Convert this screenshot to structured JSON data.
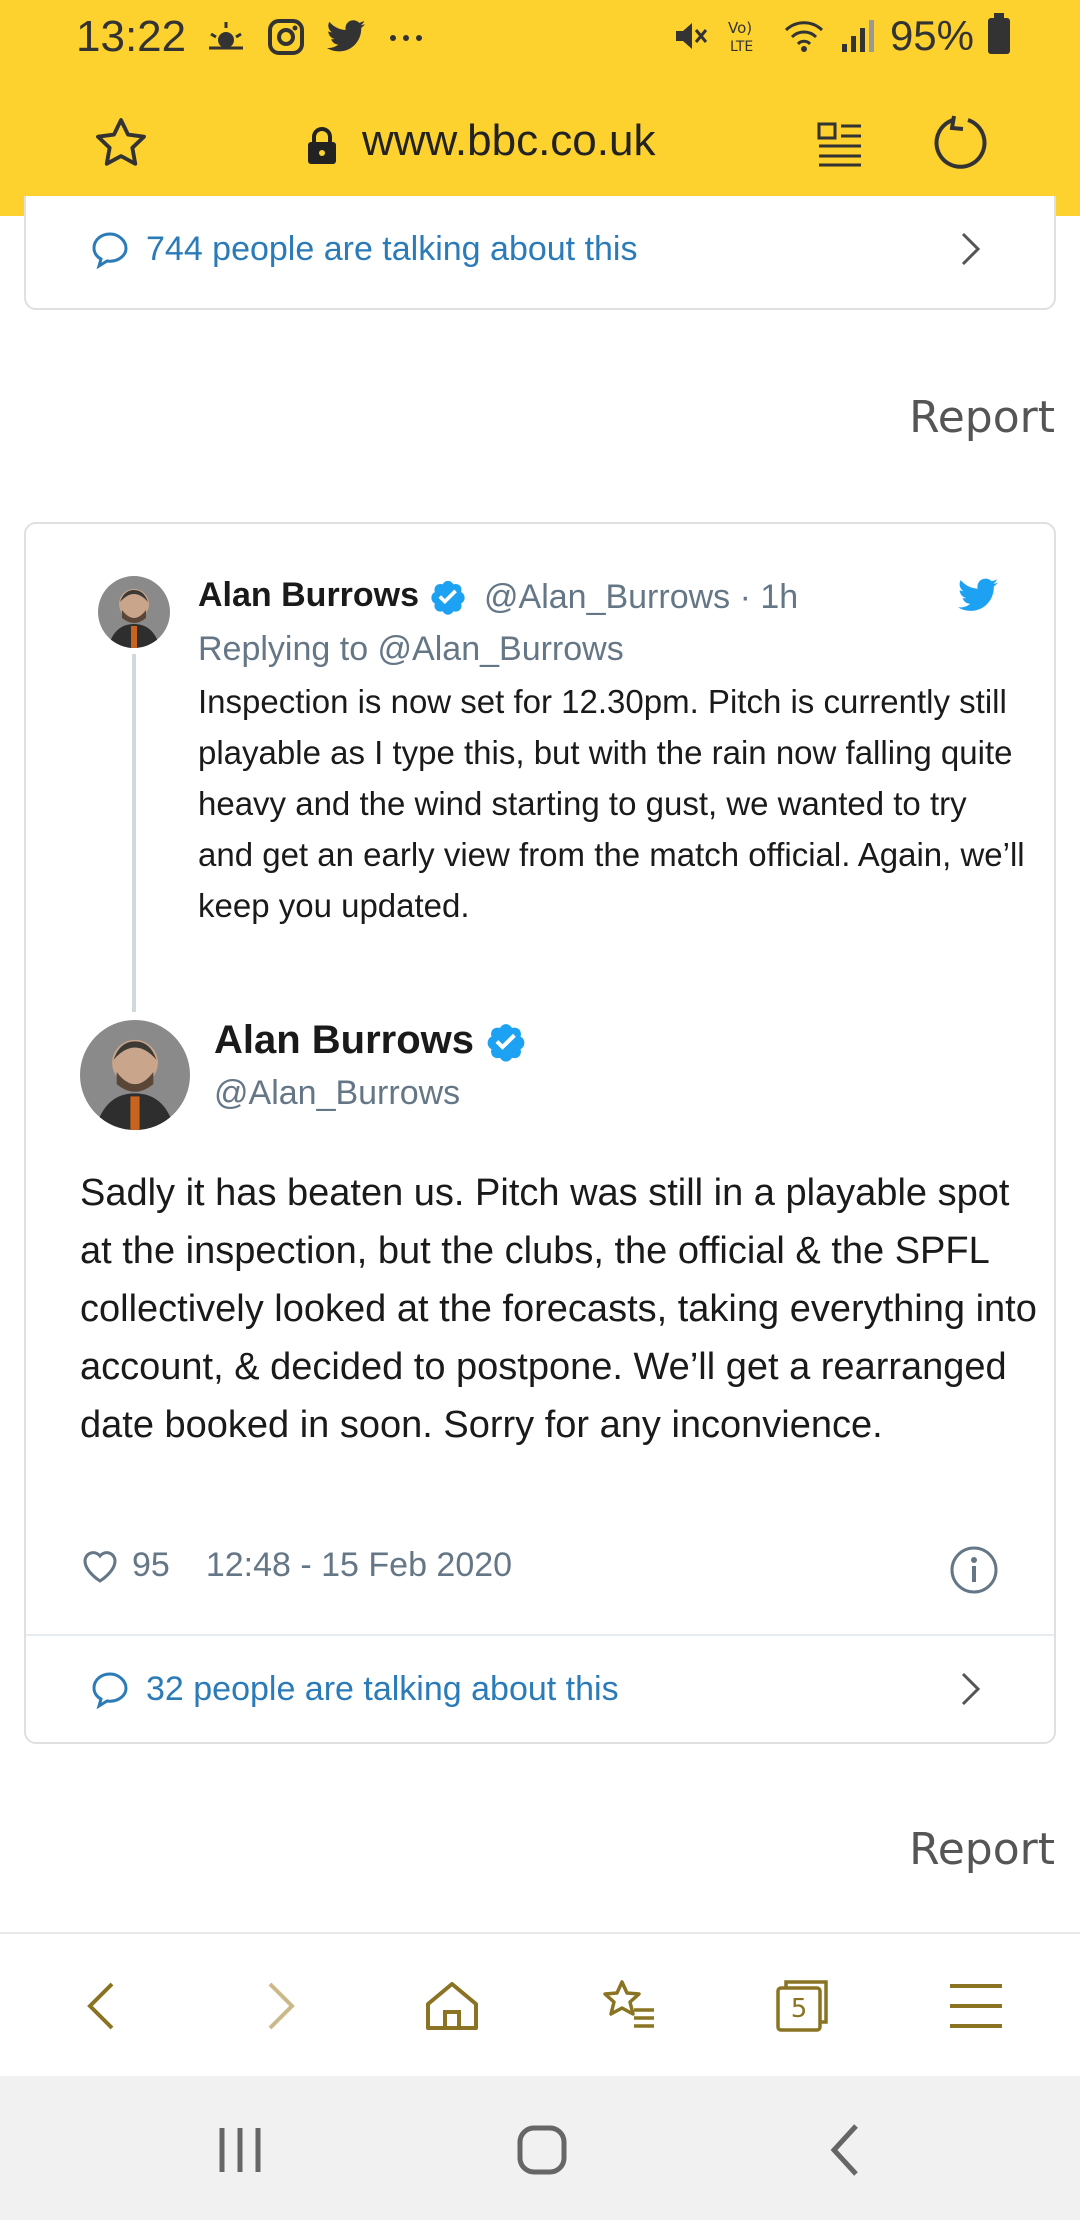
{
  "status_bar": {
    "time": "13:22",
    "battery": "95%",
    "notification_icons": [
      "weather-icon",
      "instagram-icon",
      "twitter-icon",
      "more-icon"
    ]
  },
  "browser": {
    "url": "www.bbc.co.uk",
    "accent_color": "#FDD22F"
  },
  "embed_prev": {
    "talk_text": "744 people are talking about this"
  },
  "report_1": "Report",
  "tweet": {
    "quoted": {
      "name": "Alan Burrows",
      "handle_time": "@Alan_Burrows · 1h",
      "replying_to": "Replying to @Alan_Burrows",
      "text": "Inspection is now set for 12.30pm. Pitch is currently still playable as I type this, but with the rain now falling quite heavy and the wind starting to gust, we wanted to try and get an early view from the match official. Again, we’ll keep you updated."
    },
    "main": {
      "name": "Alan Burrows",
      "handle": "@Alan_Burrows",
      "text": "Sadly it has beaten us. Pitch was still in a playable spot at the inspection, but the clubs, the official & the SPFL collectively looked at the forecasts, taking everything into account, & decided to postpone. We’ll get a rearranged date booked in soon. Sorry for any inconvience.",
      "likes": "95",
      "timestamp": "12:48 - 15 Feb 2020"
    },
    "talk_text": "32 people are talking about this",
    "link_color": "#2b7bb9"
  },
  "report_2": "Report",
  "toolbar": {
    "tabs_count": "5",
    "icon_color": "#8a7424"
  }
}
